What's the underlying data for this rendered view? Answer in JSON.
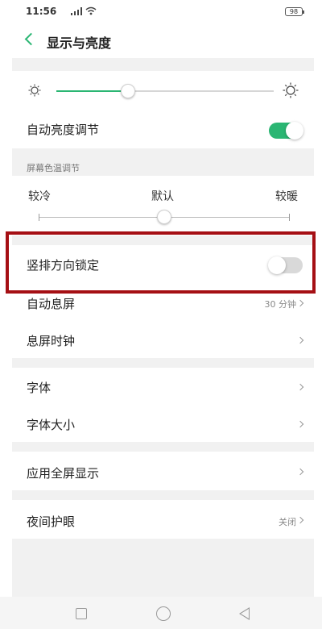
{
  "status_bar": {
    "time": "11:56",
    "battery": "98"
  },
  "header": {
    "title": "显示与亮度"
  },
  "brightness": {
    "level_percent": 33,
    "auto_label": "自动亮度调节",
    "auto_enabled": true
  },
  "color_temperature": {
    "caption": "屏幕色温调节",
    "cool_label": "较冷",
    "default_label": "默认",
    "warm_label": "较暖",
    "position_percent": 50
  },
  "settings": {
    "portrait_lock_label": "竖排方向锁定",
    "portrait_lock_enabled": false,
    "auto_screen_off_label": "自动息屏",
    "auto_screen_off_value": "30 分钟",
    "screen_off_clock_label": "息屏时钟",
    "font_label": "字体",
    "font_size_label": "字体大小",
    "fullscreen_apps_label": "应用全屏显示",
    "night_mode_label": "夜间护眼",
    "night_mode_value": "关闭"
  },
  "colors": {
    "accent": "#2bb673",
    "highlight_box": "#a50f14",
    "toggle_off": "#d9d9d9"
  }
}
